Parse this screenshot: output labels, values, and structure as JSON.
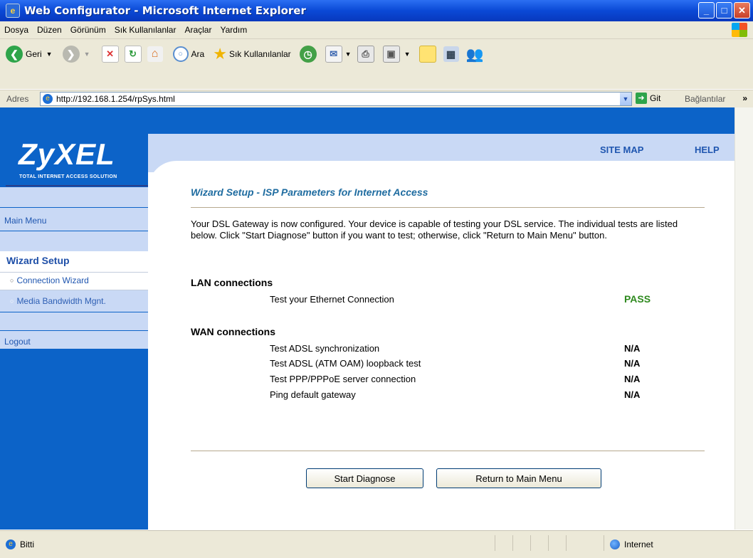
{
  "window": {
    "title": "Web Configurator - Microsoft Internet Explorer",
    "buttons": [
      "_",
      "□",
      "✕"
    ]
  },
  "menu": [
    "Dosya",
    "Düzen",
    "Görünüm",
    "Sık Kullanılanlar",
    "Araçlar",
    "Yardım"
  ],
  "toolbar": {
    "back_label": "Geri",
    "search_label": "Ara",
    "favorites_label": "Sık Kullanılanlar"
  },
  "address": {
    "label": "Adres",
    "url": "http://192.168.1.254/rpSys.html",
    "go_label": "Git",
    "links_label": "Bağlantılar"
  },
  "brand": {
    "logo": "ZyXEL",
    "tagline": "TOTAL INTERNET ACCESS SOLUTION"
  },
  "top_links": {
    "site_map": "SITE MAP",
    "help": "HELP"
  },
  "sidebar": {
    "main_menu": "Main Menu",
    "section": "Wizard Setup",
    "items": [
      "Connection Wizard",
      "Media Bandwidth Mgnt."
    ],
    "logout": "Logout"
  },
  "main": {
    "heading": "Wizard Setup - ISP Parameters for Internet Access",
    "intro": "Your DSL Gateway is now configured. Your device is capable of testing your DSL service. The individual tests are listed below. Click \"Start Diagnose\" button if you want to test; otherwise, click \"Return to Main Menu\" button.",
    "lan": {
      "title": "LAN connections",
      "tests": [
        {
          "label": "Test your Ethernet Connection",
          "result": "PASS"
        }
      ]
    },
    "wan": {
      "title": "WAN connections",
      "tests": [
        {
          "label": "Test ADSL synchronization",
          "result": "N/A"
        },
        {
          "label": "Test ADSL (ATM OAM) loopback test",
          "result": "N/A"
        },
        {
          "label": "Test PPP/PPPoE server connection",
          "result": "N/A"
        },
        {
          "label": "Ping default gateway",
          "result": "N/A"
        }
      ]
    },
    "buttons": {
      "start": "Start Diagnose",
      "return": "Return to Main Menu"
    }
  },
  "status": {
    "left": "Bitti",
    "zone": "Internet"
  },
  "colors": {
    "brand_blue": "#0c63c8",
    "light_band": "#c9d9f5",
    "pass_green": "#2f8a1f",
    "heading_blue": "#1f6ca0"
  }
}
